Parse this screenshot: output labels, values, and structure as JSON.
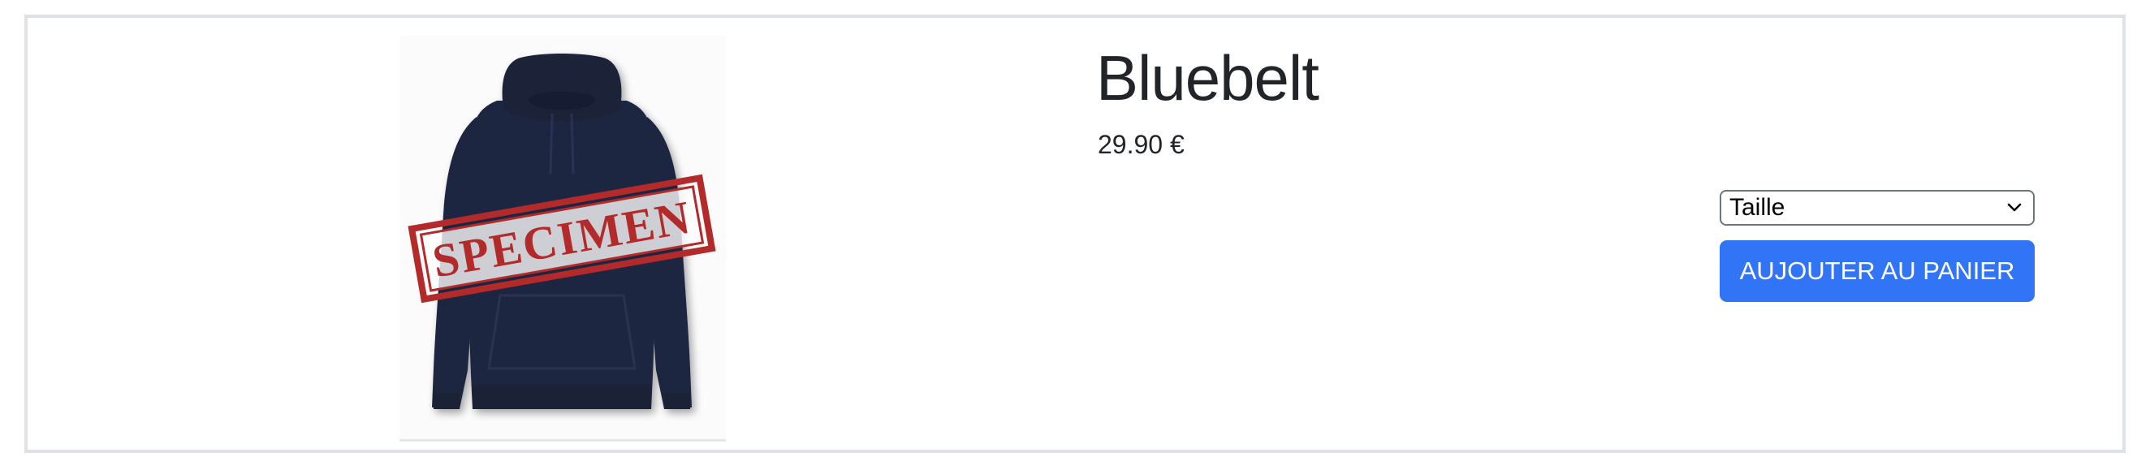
{
  "product": {
    "name": "Bluebelt",
    "price": "29.90 €",
    "image": {
      "garment_color": "#1f2540",
      "stamp_text": "SPECIMEN",
      "stamp_color": "#b32a2a"
    }
  },
  "size_select": {
    "selected": "Taille"
  },
  "actions": {
    "add_to_cart_label": "AUJOUTER AU PANIER",
    "button_color": "#3174f6"
  }
}
